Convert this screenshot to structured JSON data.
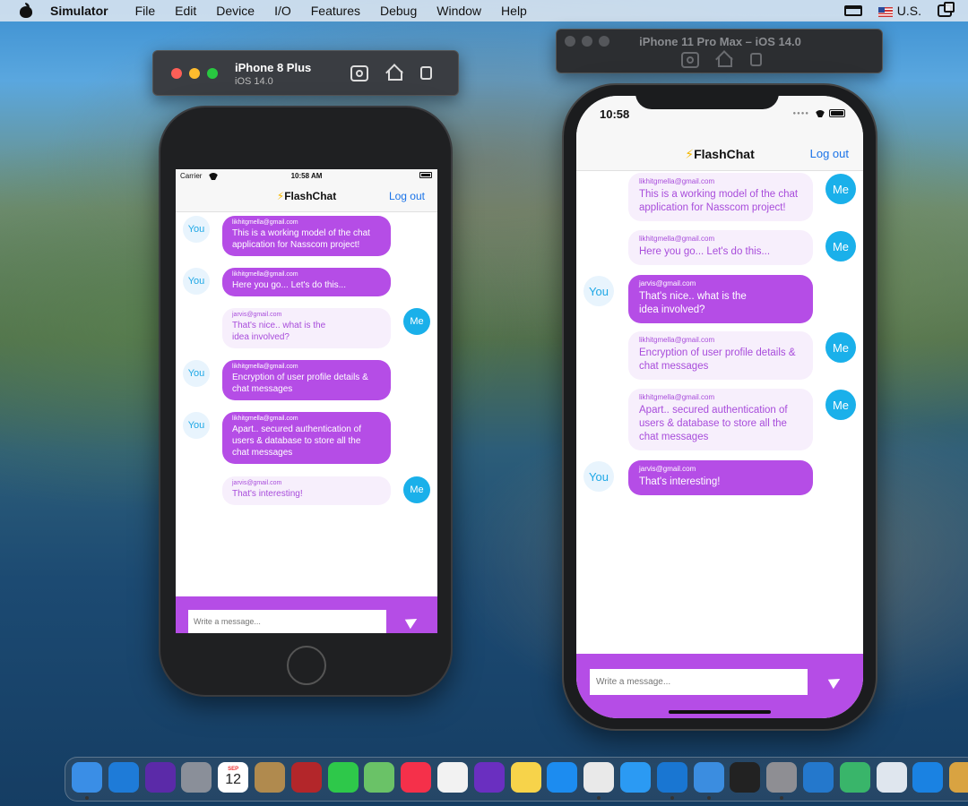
{
  "menubar": {
    "app": "Simulator",
    "items": [
      "File",
      "Edit",
      "Device",
      "I/O",
      "Features",
      "Debug",
      "Window",
      "Help"
    ],
    "input_source": "U.S."
  },
  "sim1": {
    "title": "iPhone 8 Plus",
    "subtitle": "iOS 14.0"
  },
  "sim2": {
    "title": "iPhone 11 Pro Max – iOS 14.0"
  },
  "phone8": {
    "carrier": "Carrier",
    "time": "10:58 AM",
    "nav_title": "FlashChat",
    "logout": "Log out",
    "placeholder": "Write a message...",
    "messages": [
      {
        "side": "you",
        "avatar": "You",
        "sender": "likhitgmella@gmail.com",
        "text": "This is a working model of the chat\napplication for Nasscom project!"
      },
      {
        "side": "you",
        "avatar": "You",
        "sender": "likhitgmella@gmail.com",
        "text": "Here you go... Let's do this..."
      },
      {
        "side": "me",
        "avatar": "Me",
        "sender": "jarvis@gmail.com",
        "text": "That's nice.. what is the\nidea involved?"
      },
      {
        "side": "you",
        "avatar": "You",
        "sender": "likhitgmella@gmail.com",
        "text": "Encryption of user profile details &\nchat messages"
      },
      {
        "side": "you",
        "avatar": "You",
        "sender": "likhitgmella@gmail.com",
        "text": "Apart.. secured authentication of\nusers & database to store all the\nchat messages"
      },
      {
        "side": "me",
        "avatar": "Me",
        "sender": "jarvis@gmail.com",
        "text": "That's interesting!"
      }
    ]
  },
  "phone11": {
    "time": "10:58",
    "nav_title": "FlashChat",
    "logout": "Log out",
    "placeholder": "Write a message...",
    "messages": [
      {
        "side": "me",
        "avatar": "Me",
        "sender": "likhitgmella@gmail.com",
        "text": "This is a working model of the chat\napplication for Nasscom project!"
      },
      {
        "side": "me",
        "avatar": "Me",
        "sender": "likhitgmella@gmail.com",
        "text": "Here you go... Let's do this..."
      },
      {
        "side": "you",
        "avatar": "You",
        "sender": "jarvis@gmail.com",
        "text": "That's nice.. what is the\nidea involved?"
      },
      {
        "side": "me",
        "avatar": "Me",
        "sender": "likhitgmella@gmail.com",
        "text": "Encryption of user profile details &\nchat messages"
      },
      {
        "side": "me",
        "avatar": "Me",
        "sender": "likhitgmella@gmail.com",
        "text": "Apart.. secured authentication of\nusers & database to store all the\nchat messages"
      },
      {
        "side": "you",
        "avatar": "You",
        "sender": "jarvis@gmail.com",
        "text": "That's interesting!"
      }
    ]
  },
  "dock": {
    "calendar_month": "SEP",
    "calendar_day": "12",
    "apps": [
      {
        "name": "finder-icon",
        "color": "#3a8ee6"
      },
      {
        "name": "bluetooth-icon",
        "color": "#1e7bd8"
      },
      {
        "name": "siri-icon",
        "color": "#5b2aa8"
      },
      {
        "name": "launchpad-icon",
        "color": "#8a8f99"
      },
      {
        "name": "calendar-icon",
        "color": "#ffffff"
      },
      {
        "name": "contacts-icon",
        "color": "#b08a4e"
      },
      {
        "name": "dictionary-icon",
        "color": "#b3262a"
      },
      {
        "name": "facetime-icon",
        "color": "#2ec84a"
      },
      {
        "name": "maps-icon",
        "color": "#6ac267"
      },
      {
        "name": "music-icon",
        "color": "#f5304a"
      },
      {
        "name": "photos-icon",
        "color": "#f2f2f2"
      },
      {
        "name": "imovie-icon",
        "color": "#6a2fc0"
      },
      {
        "name": "notes-icon",
        "color": "#f7d34a"
      },
      {
        "name": "app-store-icon",
        "color": "#1c8cf0"
      },
      {
        "name": "chrome-icon",
        "color": "#e9e9e9"
      },
      {
        "name": "safari-icon",
        "color": "#2b9af3"
      },
      {
        "name": "xcode-icon",
        "color": "#1976d2"
      },
      {
        "name": "xcode-beta-icon",
        "color": "#3b8de0"
      },
      {
        "name": "terminal-icon",
        "color": "#222222"
      },
      {
        "name": "system-preferences-icon",
        "color": "#8e8e93"
      },
      {
        "name": "vscode-icon",
        "color": "#2478cc"
      },
      {
        "name": "atom-icon",
        "color": "#39b56a"
      },
      {
        "name": "preview-icon",
        "color": "#dfe6ee"
      },
      {
        "name": "keynote-icon",
        "color": "#1a82e2"
      },
      {
        "name": "finder-window-icon",
        "color": "#d9a341"
      }
    ]
  }
}
